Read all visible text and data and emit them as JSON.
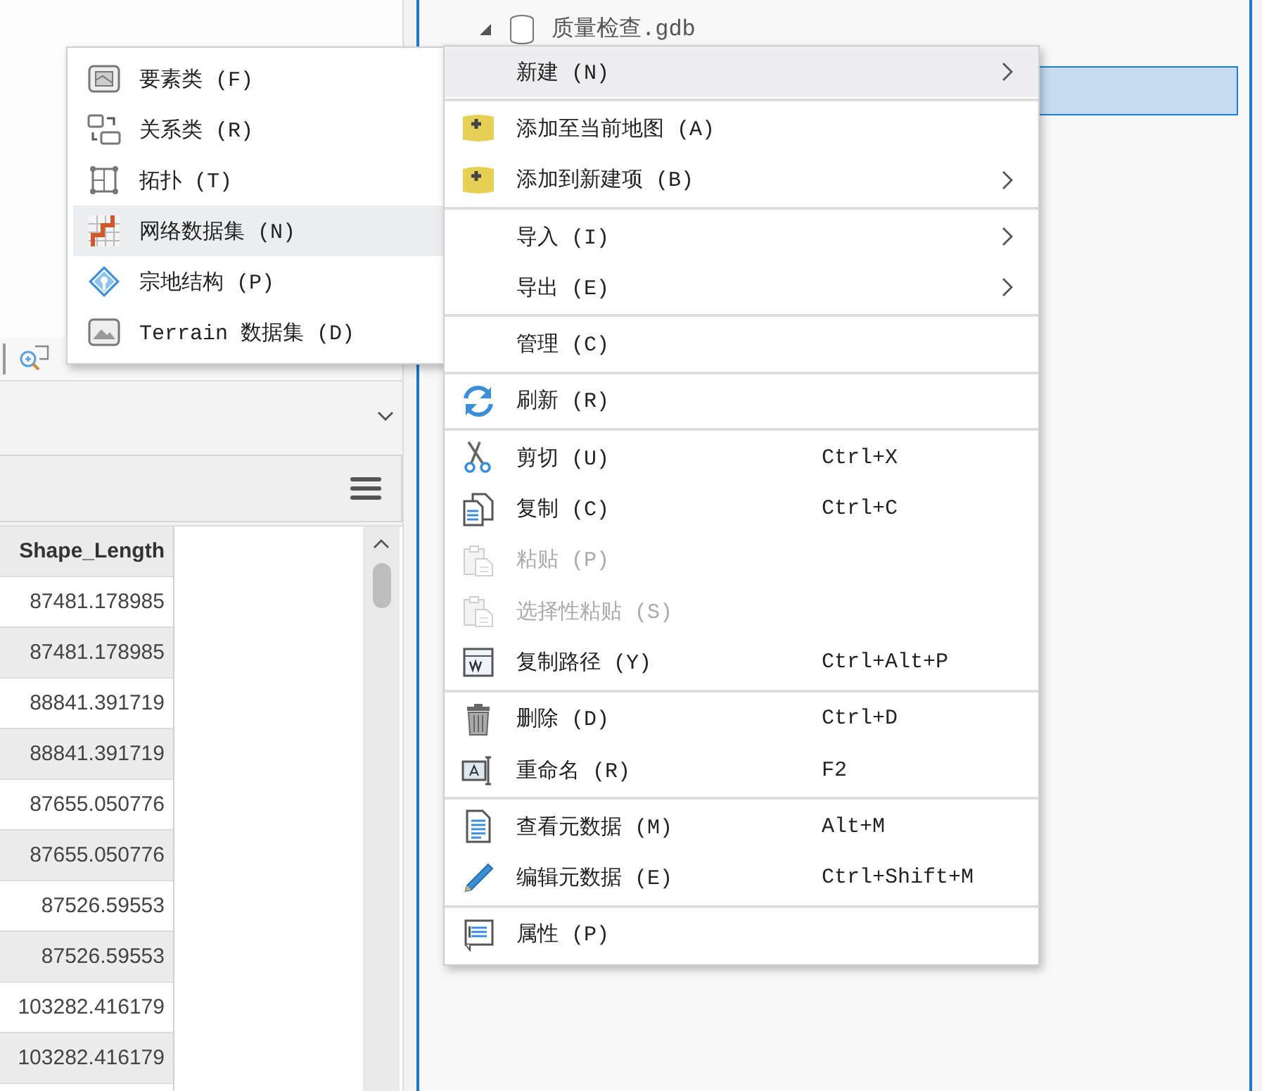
{
  "attribute_table": {
    "columns": [
      "Shape_Length"
    ],
    "rows": [
      "87481.178985",
      "87481.178985",
      "88841.391719",
      "88841.391719",
      "87655.050776",
      "87655.050776",
      "87526.59553",
      "87526.59553",
      "103282.416179",
      "103282.416179"
    ]
  },
  "catalog_tree": {
    "items": [
      {
        "label": "质量检查.gdb",
        "expanded": true,
        "children": [
          {
            "selected": true
          }
        ]
      }
    ]
  },
  "context_menu": {
    "items": [
      {
        "kind": "item",
        "label": "新建 (N)",
        "submenu": true,
        "highlighted": true,
        "disabled": false
      },
      {
        "kind": "separator"
      },
      {
        "kind": "item",
        "label": "添加至当前地图 (A)",
        "submenu": false,
        "highlighted": false,
        "disabled": false
      },
      {
        "kind": "item",
        "label": "添加到新建项 (B)",
        "submenu": true,
        "highlighted": false,
        "disabled": false
      },
      {
        "kind": "separator"
      },
      {
        "kind": "item",
        "label": "导入 (I)",
        "submenu": true,
        "highlighted": false,
        "disabled": false
      },
      {
        "kind": "item",
        "label": "导出 (E)",
        "submenu": true,
        "highlighted": false,
        "disabled": false
      },
      {
        "kind": "separator"
      },
      {
        "kind": "item",
        "label": "管理 (C)",
        "submenu": false,
        "highlighted": false,
        "disabled": false
      },
      {
        "kind": "separator"
      },
      {
        "kind": "item",
        "label": "刷新 (R)",
        "submenu": false,
        "highlighted": false,
        "disabled": false
      },
      {
        "kind": "separator"
      },
      {
        "kind": "item",
        "label": "剪切 (U)",
        "shortcut": "Ctrl+X",
        "submenu": false,
        "highlighted": false,
        "disabled": false
      },
      {
        "kind": "item",
        "label": "复制 (C)",
        "shortcut": "Ctrl+C",
        "submenu": false,
        "highlighted": false,
        "disabled": false
      },
      {
        "kind": "item",
        "label": "粘贴 (P)",
        "submenu": false,
        "highlighted": false,
        "disabled": true
      },
      {
        "kind": "item",
        "label": "选择性粘贴 (S)",
        "submenu": false,
        "highlighted": false,
        "disabled": true
      },
      {
        "kind": "item",
        "label": "复制路径 (Y)",
        "shortcut": "Ctrl+Alt+P",
        "submenu": false,
        "highlighted": false,
        "disabled": false
      },
      {
        "kind": "separator"
      },
      {
        "kind": "item",
        "label": "删除 (D)",
        "shortcut": "Ctrl+D",
        "submenu": false,
        "highlighted": false,
        "disabled": false
      },
      {
        "kind": "item",
        "label": "重命名 (R)",
        "shortcut": "F2",
        "submenu": false,
        "highlighted": false,
        "disabled": false
      },
      {
        "kind": "separator"
      },
      {
        "kind": "item",
        "label": "查看元数据 (M)",
        "shortcut": "Alt+M",
        "submenu": false,
        "highlighted": false,
        "disabled": false
      },
      {
        "kind": "item",
        "label": "编辑元数据 (E)",
        "shortcut": "Ctrl+Shift+M",
        "submenu": false,
        "highlighted": false,
        "disabled": false
      },
      {
        "kind": "separator"
      },
      {
        "kind": "item",
        "label": "属性 (P)",
        "submenu": false,
        "highlighted": false,
        "disabled": false
      }
    ]
  },
  "submenu": {
    "items": [
      {
        "label": "要素类 (F)",
        "highlighted": false
      },
      {
        "label": "关系类 (R)",
        "highlighted": false
      },
      {
        "label": "拓扑 (T)",
        "highlighted": false
      },
      {
        "label": "网络数据集 (N)",
        "highlighted": true
      },
      {
        "label": "宗地结构 (P)",
        "highlighted": false
      },
      {
        "label": "Terrain 数据集 (D)",
        "highlighted": false
      }
    ]
  }
}
